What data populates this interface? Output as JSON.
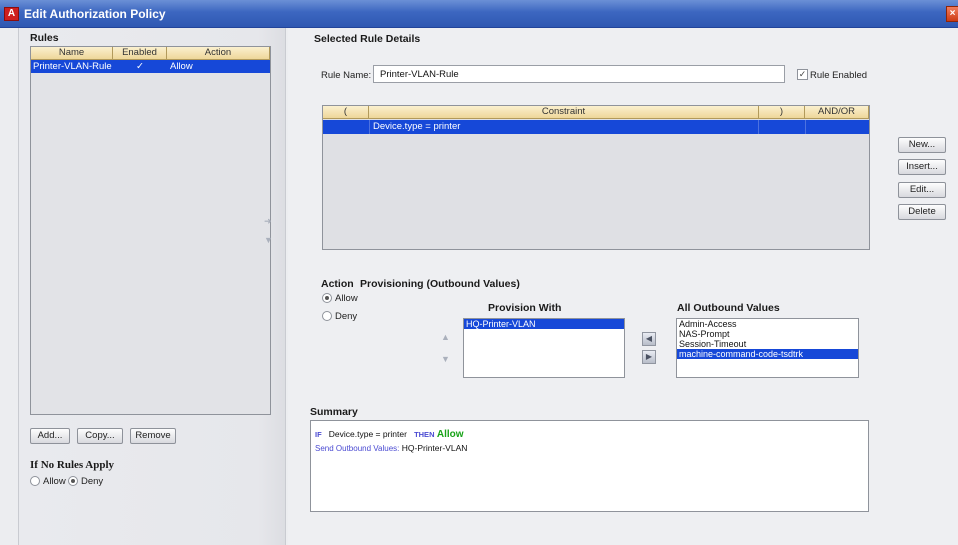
{
  "window": {
    "title": "Edit Authorization Policy",
    "close_icon": "close-icon",
    "app_icon_letter": "A"
  },
  "rules_panel": {
    "title": "Rules",
    "columns": [
      "Name",
      "Enabled",
      "Action"
    ],
    "rows": [
      {
        "name": "Printer-VLAN-Rule",
        "enabled": "✓",
        "action": "Allow",
        "selected": true
      }
    ],
    "buttons": {
      "add": "Add...",
      "copy": "Copy...",
      "remove": "Remove"
    },
    "no_rules": {
      "title": "If No Rules Apply",
      "allow": "Allow",
      "deny": "Deny",
      "selected": "Deny"
    }
  },
  "rule_details": {
    "title": "Selected Rule Details",
    "rule_name_label": "Rule Name:",
    "rule_name_value": "Printer-VLAN-Rule",
    "rule_enabled_label": "Rule Enabled",
    "rule_enabled_checked": true,
    "constraint_table": {
      "columns": [
        "(",
        "Constraint",
        ")",
        "AND/OR"
      ],
      "rows": [
        {
          "open": "",
          "constraint": "Device.type  =  printer",
          "close": "",
          "andor": ""
        }
      ]
    },
    "side_buttons": {
      "new": "New...",
      "insert": "Insert...",
      "edit": "Edit...",
      "delete": "Delete"
    }
  },
  "provisioning": {
    "action_title": "Action",
    "provisioning_title": "Provisioning (Outbound Values)",
    "allow": "Allow",
    "deny": "Deny",
    "selected": "Allow",
    "provision_with_title": "Provision With",
    "provision_with": [
      "HQ-Printer-VLAN"
    ],
    "all_outbound_title": "All Outbound Values",
    "all_outbound": [
      "Admin-Access",
      "NAS-Prompt",
      "Session-Timeout",
      "machine-command-code-tsdtrk"
    ],
    "all_outbound_selected": "machine-command-code-tsdtrk"
  },
  "summary": {
    "title": "Summary",
    "if_kw": "IF",
    "condition": "Device.type  =  printer",
    "then_kw": "THEN",
    "action": "Allow",
    "send_label": "Send Outbound Values:",
    "send_value": "HQ-Printer-VLAN"
  },
  "colors": {
    "title_bar": "#3c66c0",
    "selection": "#1648d8",
    "allow_green": "#18a318",
    "keyword_blue": "#4a4ad2",
    "close_button": "#cc3b15"
  }
}
